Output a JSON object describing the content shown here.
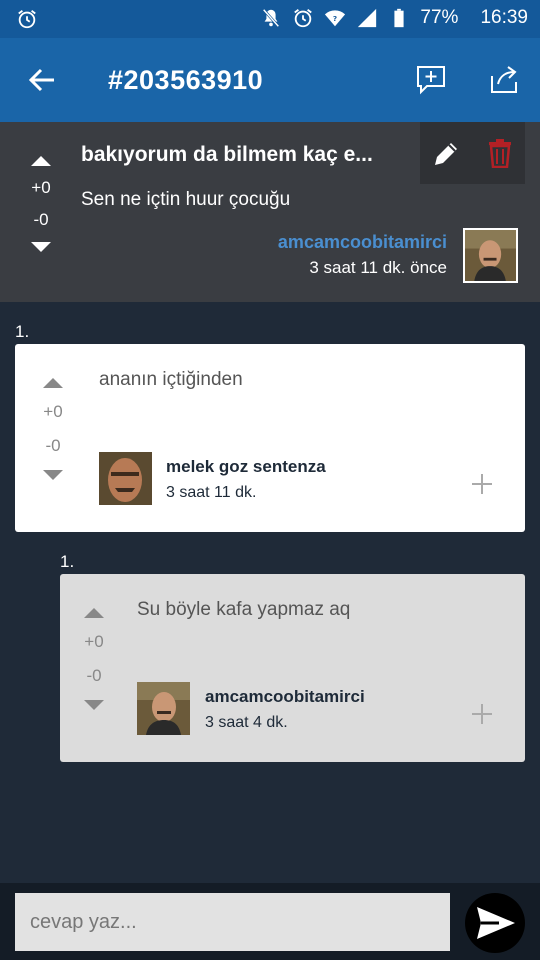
{
  "status_bar": {
    "battery": "77%",
    "time": "16:39"
  },
  "app_bar": {
    "title": "#203563910"
  },
  "post": {
    "title": "bakıyorum da bilmem kaç e...",
    "body": "Sen ne içtin huur çocuğu",
    "upvotes": "+0",
    "downvotes": "-0",
    "author": "amcamcoobitamirci",
    "time": "3 saat 11 dk. önce"
  },
  "comments": [
    {
      "number": "1.",
      "text": "ananın içtiğinden",
      "upvotes": "+0",
      "downvotes": "-0",
      "author": "melek goz sentenza",
      "time": "3 saat 11 dk."
    },
    {
      "number": "1.",
      "text": "Su böyle kafa yapmaz aq",
      "upvotes": "+0",
      "downvotes": "-0",
      "author": "amcamcoobitamirci",
      "time": "3 saat 4 dk."
    }
  ],
  "reply": {
    "placeholder": "cevap yaz..."
  },
  "colors": {
    "app_bar": "#1a65a8",
    "status_bar": "#14599a",
    "background": "#1f2a38",
    "author_link": "#4a8fd0",
    "delete": "#b32025"
  }
}
